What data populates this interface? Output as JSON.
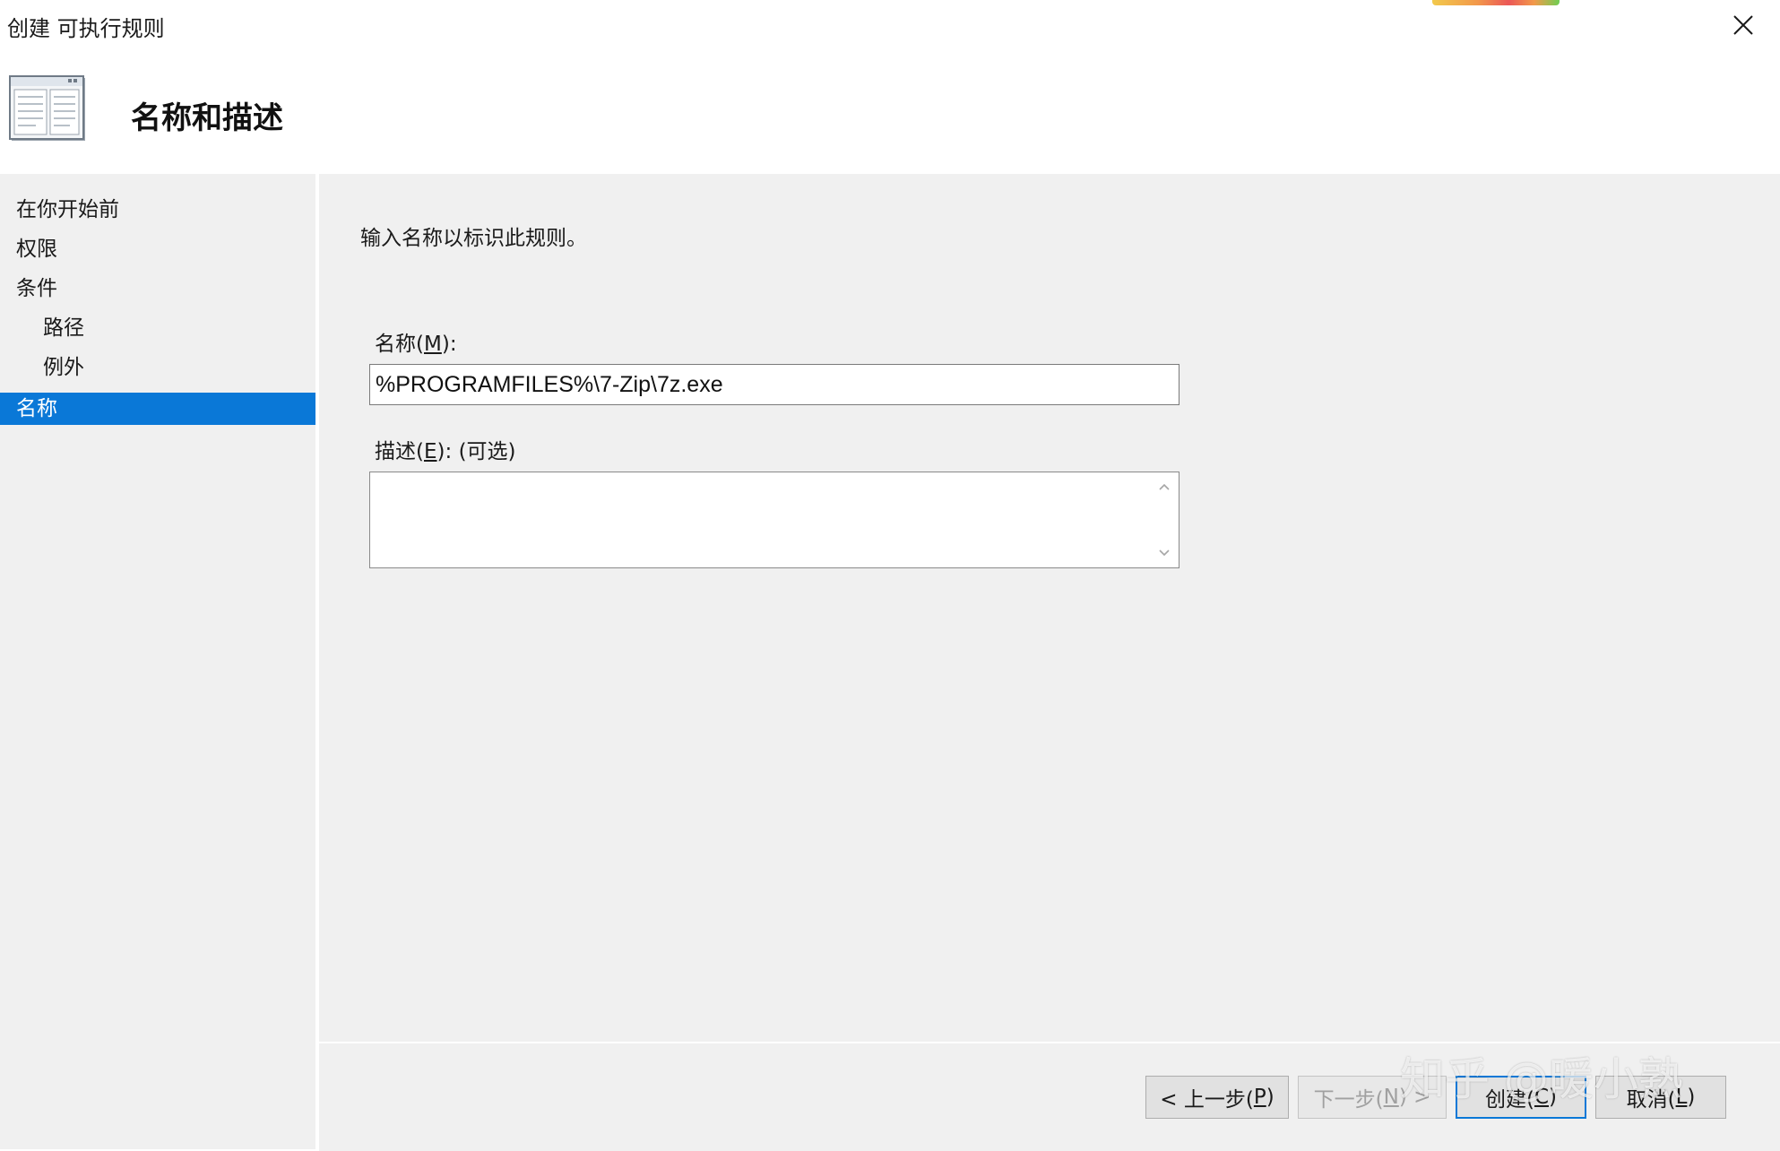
{
  "window": {
    "title": "创建 可执行规则",
    "close_icon": "close-icon"
  },
  "header": {
    "title": "名称和描述",
    "icon": "window-list-icon"
  },
  "sidebar": {
    "items": [
      {
        "label": "在你开始前",
        "level": 1,
        "selected": false
      },
      {
        "label": "权限",
        "level": 1,
        "selected": false
      },
      {
        "label": "条件",
        "level": 1,
        "selected": false
      },
      {
        "label": "路径",
        "level": 2,
        "selected": false
      },
      {
        "label": "例外",
        "level": 2,
        "selected": false
      },
      {
        "label": "名称",
        "level": 1,
        "selected": true
      }
    ]
  },
  "main": {
    "instruction": "输入名称以标识此规则。",
    "name_field": {
      "label_prefix": "名称(",
      "label_key": "M",
      "label_suffix": "):",
      "value": "%PROGRAMFILES%\\7-Zip\\7z.exe"
    },
    "description_field": {
      "label_prefix": "描述(",
      "label_key": "E",
      "label_suffix": "): (可选)",
      "value": ""
    }
  },
  "footer": {
    "buttons": {
      "back": {
        "prefix": "< 上一步(",
        "key": "P",
        "suffix": ")",
        "enabled": true
      },
      "next": {
        "prefix": "下一步(",
        "key": "N",
        "suffix": ") >",
        "enabled": false
      },
      "create": {
        "prefix": "创建(",
        "key": "C",
        "suffix": ")",
        "enabled": true,
        "default": true
      },
      "cancel": {
        "prefix": "取消(",
        "key": "L",
        "suffix": ")",
        "enabled": true
      }
    }
  },
  "watermark": "知乎 @暖小熟",
  "colors": {
    "selection": "#0a78d7",
    "panel_background": "#f0f0f0",
    "default_button_border": "#0a78d7"
  }
}
